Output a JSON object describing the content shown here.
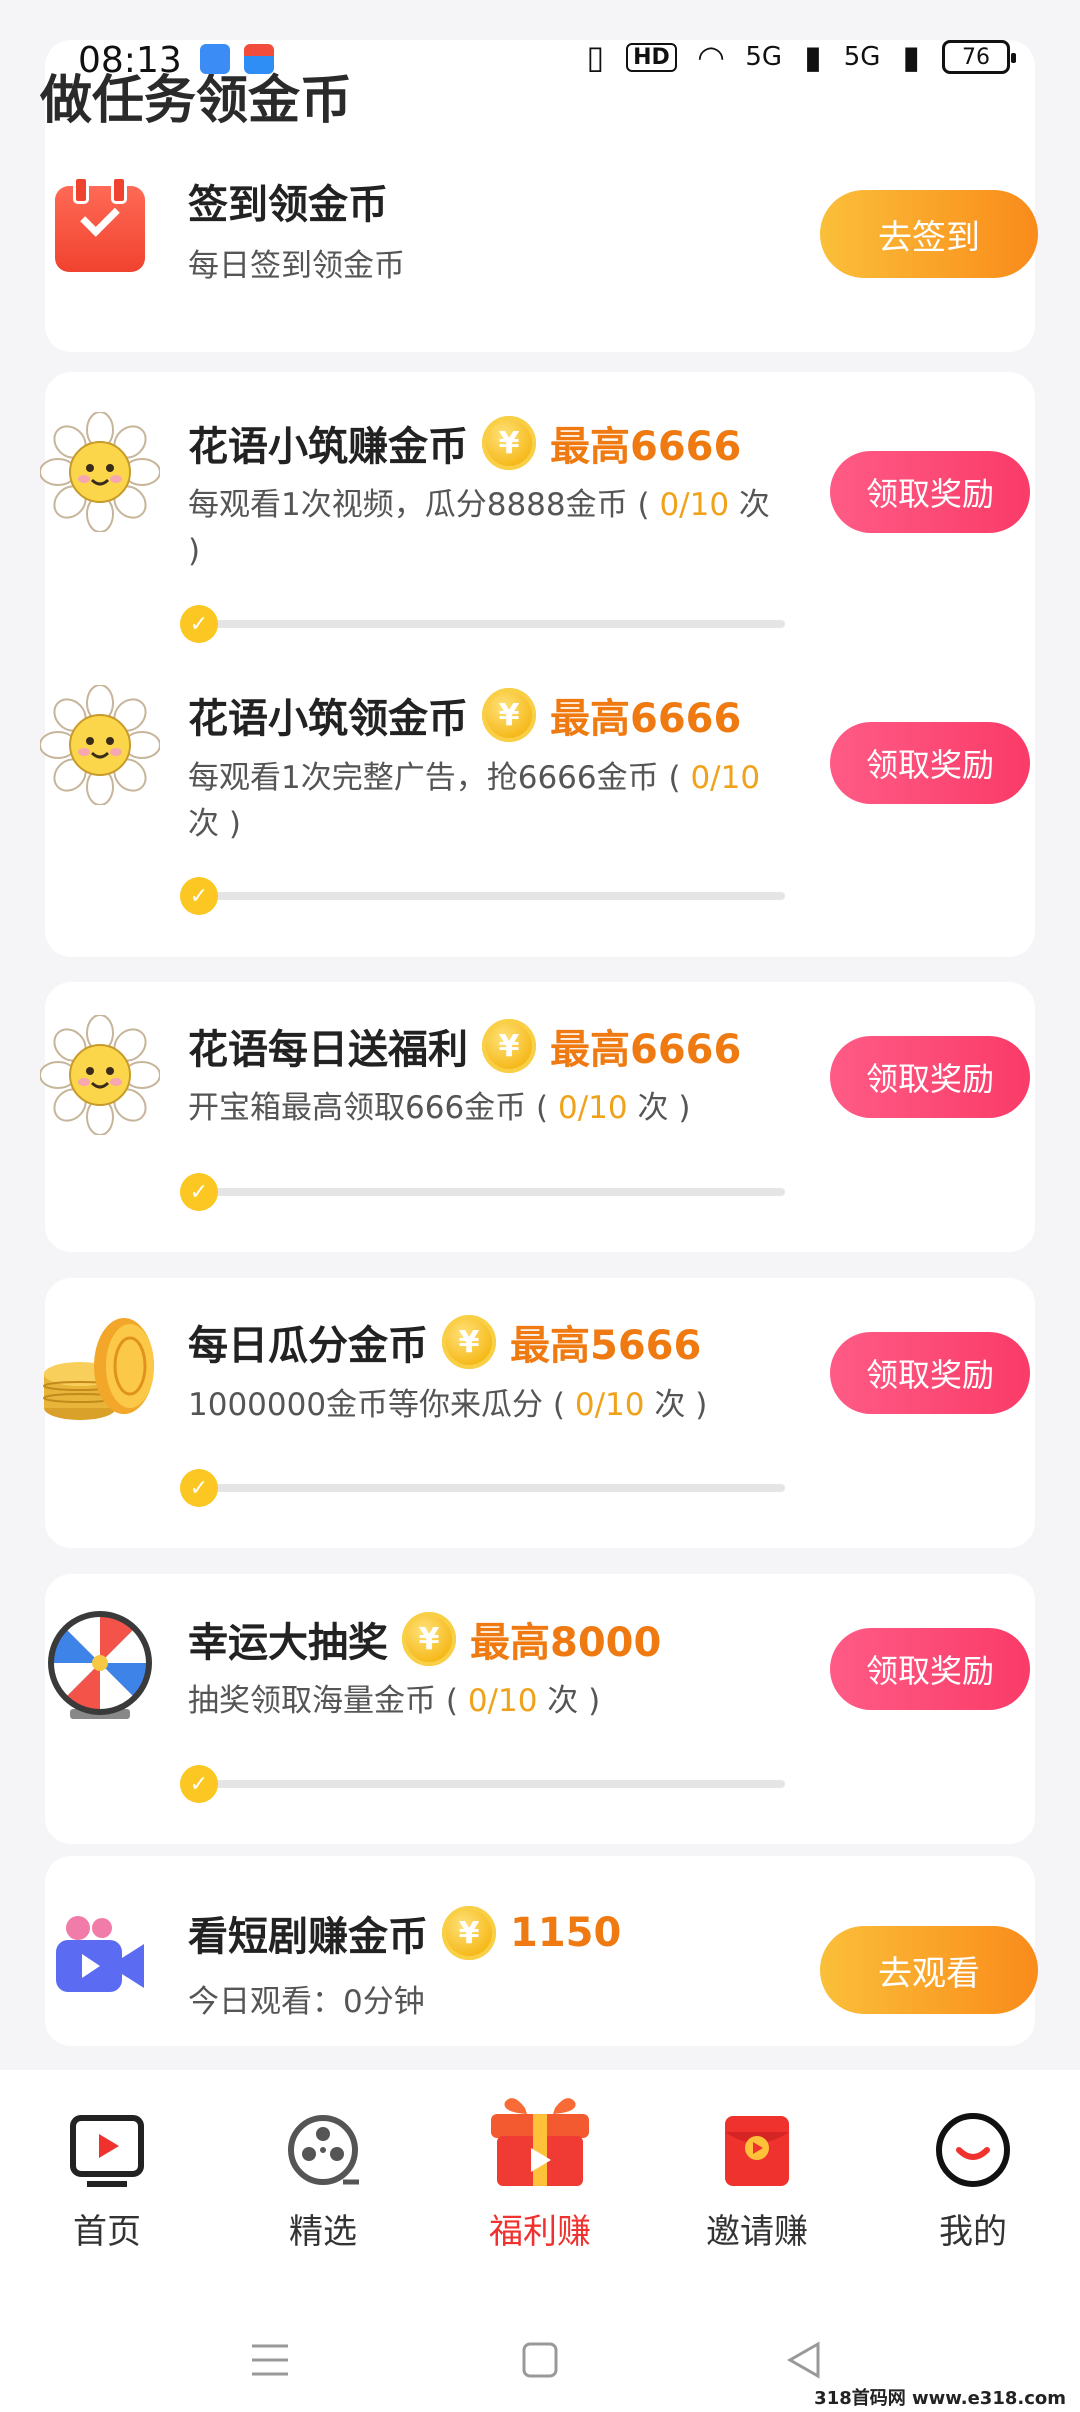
{
  "status_bar": {
    "time": "08:13",
    "network": "5G",
    "battery": "76"
  },
  "page": {
    "title": "做任务领金币"
  },
  "signin": {
    "title": "签到领金币",
    "desc": "每日签到领金币",
    "button": "去签到"
  },
  "tasks": [
    {
      "title": "花语小筑赚金币",
      "coin_symbol": "¥",
      "max": "最高6666",
      "desc_prefix": "每观看1次视频，瓜分8888金币 (",
      "progress": "0/10",
      "desc_suffix": "次 )",
      "progress_fraction": 0,
      "button": "领取奖励"
    },
    {
      "title": "花语小筑领金币",
      "coin_symbol": "¥",
      "max": "最高6666",
      "desc_prefix": "每观看1次完整广告，抢6666金币 (",
      "progress": "0/10",
      "desc_suffix": "次 )",
      "progress_fraction": 0,
      "button": "领取奖励"
    },
    {
      "title": "花语每日送福利",
      "coin_symbol": "¥",
      "max": "最高6666",
      "desc_prefix": "开宝箱最高领取666金币 (",
      "progress": "0/10",
      "desc_suffix": "次 )",
      "progress_fraction": 0,
      "button": "领取奖励"
    },
    {
      "title": "每日瓜分金币",
      "coin_symbol": "¥",
      "max": "最高5666",
      "desc_prefix": "1000000金币等你来瓜分 (",
      "progress": "0/10",
      "desc_suffix": "次 )",
      "progress_fraction": 0,
      "button": "领取奖励"
    },
    {
      "title": "幸运大抽奖",
      "coin_symbol": "¥",
      "max": "最高8000",
      "desc_prefix": "抽奖领取海量金币 (",
      "progress": "0/10",
      "desc_suffix": "次 )",
      "progress_fraction": 0,
      "button": "领取奖励"
    }
  ],
  "drama": {
    "title": "看短剧赚金币",
    "coin_symbol": "¥",
    "amount": "1150",
    "desc": "今日观看：0分钟",
    "button": "去观看"
  },
  "nav": {
    "items": [
      {
        "label": "首页",
        "icon": "tv-play-icon"
      },
      {
        "label": "精选",
        "icon": "film-reel-icon"
      },
      {
        "label": "福利赚",
        "icon": "gift-box-icon"
      },
      {
        "label": "邀请赚",
        "icon": "red-envelope-icon"
      },
      {
        "label": "我的",
        "icon": "smile-face-icon"
      }
    ],
    "active_index": 2
  },
  "watermark": "318首码网 www.e318.com"
}
